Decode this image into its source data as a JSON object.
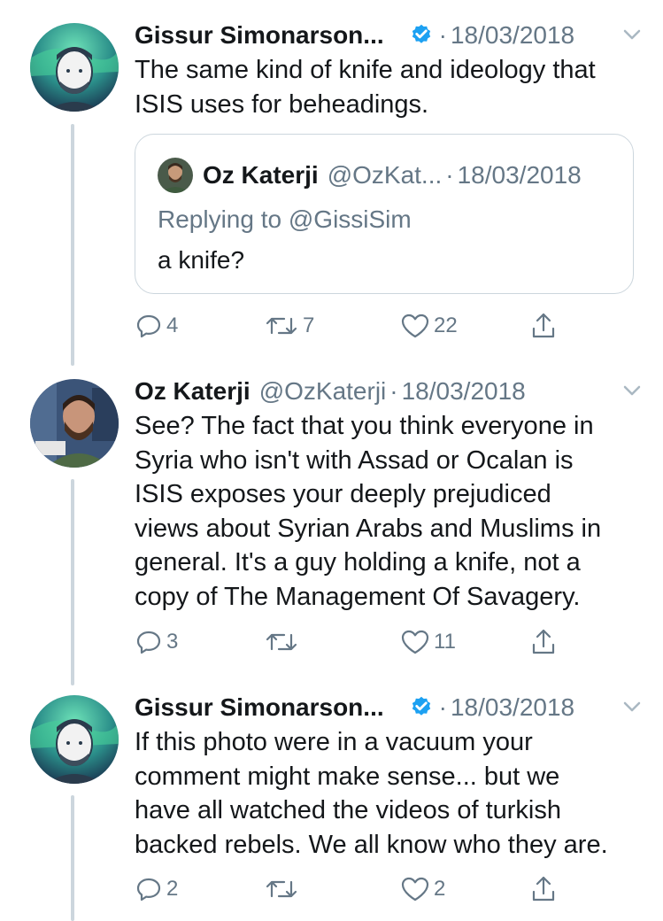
{
  "tweets": [
    {
      "author_name": "Gissur Simonarson...",
      "verified": true,
      "handle": "",
      "date": "18/03/2018",
      "text_lines": [
        "The same kind of knife and ideology that",
        "ISIS uses for beheadings."
      ],
      "quote": {
        "author_name": "Oz Katerji",
        "handle": "@OzKat...",
        "date": "18/03/2018",
        "replying_to": "Replying to @GissiSim",
        "text": "a knife?"
      },
      "replies": "4",
      "retweets": "7",
      "likes": "22"
    },
    {
      "author_name": "Oz Katerji",
      "verified": false,
      "handle": "@OzKaterji",
      "date": "18/03/2018",
      "text_lines": [
        "See? The fact that you think everyone in",
        "Syria who isn't with Assad or Ocalan is",
        "ISIS exposes your deeply prejudiced",
        "views about Syrian Arabs and Muslims in",
        "general. It's a guy holding a knife, not a",
        "copy of The Management Of Savagery."
      ],
      "replies": "3",
      "retweets": "",
      "likes": "11"
    },
    {
      "author_name": "Gissur Simonarson...",
      "verified": true,
      "handle": "",
      "date": "18/03/2018",
      "text_lines": [
        "If this photo were in a vacuum your",
        "comment might make sense... but we",
        "have all watched the videos of turkish",
        "backed rebels. We all know who they are."
      ],
      "replies": "2",
      "retweets": "",
      "likes": "2"
    }
  ],
  "separator": "·",
  "icons": {
    "verified": "verified-badge-icon",
    "chevron": "chevron-down-icon",
    "reply": "reply-icon",
    "retweet": "retweet-icon",
    "like": "heart-icon",
    "share": "share-icon"
  },
  "colors": {
    "text": "#14171a",
    "secondary": "#657786",
    "verified": "#1da1f2",
    "border": "#ccd6dd"
  }
}
